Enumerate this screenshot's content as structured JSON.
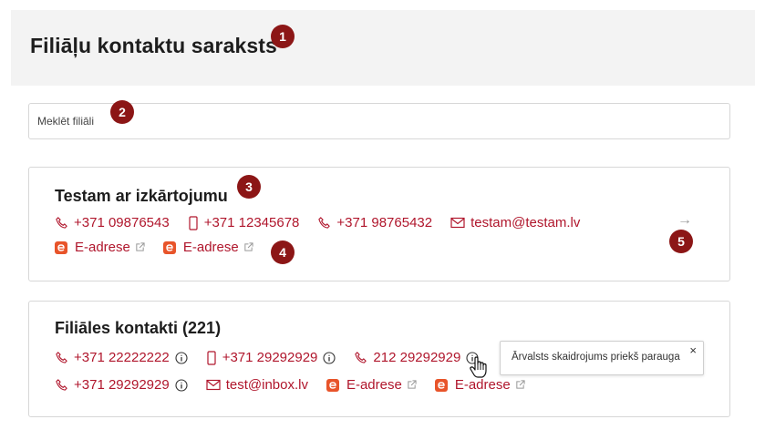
{
  "header": {
    "title": "Filiāļu kontaktu saraksts"
  },
  "search": {
    "placeholder": "Meklēt filiāli"
  },
  "cards": [
    {
      "title": "Testam ar izkārtojumu",
      "row1": [
        {
          "type": "phone",
          "icon": "phone-icon",
          "text": "+371 09876543"
        },
        {
          "type": "mobile",
          "icon": "mobile-icon",
          "text": "+371 12345678"
        },
        {
          "type": "phone",
          "icon": "phone-icon",
          "text": "+371 98765432"
        },
        {
          "type": "email",
          "icon": "mail-icon",
          "text": "testam@testam.lv"
        }
      ],
      "row2": [
        {
          "type": "eadrese",
          "icon": "e-adrese-icon",
          "text": "E-adrese"
        },
        {
          "type": "eadrese",
          "icon": "e-adrese-icon",
          "text": "E-adrese"
        }
      ],
      "arrow": "→"
    },
    {
      "title": "Filiāles kontakti (221)",
      "row1": [
        {
          "type": "phone",
          "icon": "phone-icon",
          "text": "+371 22222222"
        },
        {
          "type": "mobile",
          "icon": "mobile-icon",
          "text": "+371 29292929"
        },
        {
          "type": "phone",
          "icon": "phone-icon",
          "text": "212 29292929"
        }
      ],
      "row2": [
        {
          "type": "phone",
          "icon": "phone-icon",
          "text": "+371 29292929"
        },
        {
          "type": "email",
          "icon": "mail-icon",
          "text": "test@inbox.lv"
        },
        {
          "type": "eadrese",
          "icon": "e-adrese-icon",
          "text": "E-adrese"
        },
        {
          "type": "eadrese",
          "icon": "e-adrese-icon",
          "text": "E-adrese"
        }
      ]
    }
  ],
  "tooltip": {
    "text": "Ārvalsts skaidrojums priekš parauga",
    "close": "×"
  },
  "annotations": [
    "1",
    "2",
    "3",
    "4",
    "5"
  ],
  "colors": {
    "accent": "#b0162c",
    "badge": "#8c1616",
    "header_bg": "#f3f3f3",
    "eadrese_logo": "#e8542a"
  }
}
